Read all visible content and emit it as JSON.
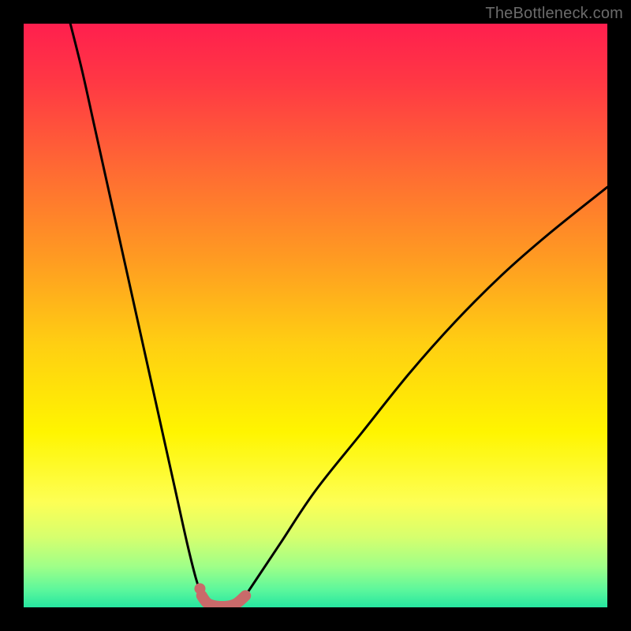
{
  "watermark": {
    "text": "TheBottleneck.com"
  },
  "colors": {
    "gradient_stops": [
      {
        "offset": 0.0,
        "color": "#ff1f4e"
      },
      {
        "offset": 0.1,
        "color": "#ff3844"
      },
      {
        "offset": 0.25,
        "color": "#ff6a33"
      },
      {
        "offset": 0.4,
        "color": "#ff9a22"
      },
      {
        "offset": 0.55,
        "color": "#ffcf12"
      },
      {
        "offset": 0.7,
        "color": "#fff500"
      },
      {
        "offset": 0.82,
        "color": "#fdff55"
      },
      {
        "offset": 0.88,
        "color": "#d6ff6e"
      },
      {
        "offset": 0.93,
        "color": "#9fff88"
      },
      {
        "offset": 0.97,
        "color": "#5cf79c"
      },
      {
        "offset": 1.0,
        "color": "#26e6a0"
      }
    ],
    "curve": "#000000",
    "marker": "#c96a6a"
  },
  "chart_data": {
    "type": "line",
    "title": "",
    "xlabel": "",
    "ylabel": "",
    "xlim": [
      0,
      100
    ],
    "ylim": [
      0,
      100
    ],
    "grid": false,
    "legend": false,
    "series": [
      {
        "name": "left-branch",
        "x": [
          8,
          10,
          12,
          14,
          16,
          18,
          20,
          22,
          24,
          26,
          28,
          29.5,
          30.5
        ],
        "y": [
          100,
          92,
          83,
          74,
          65,
          56,
          47,
          38,
          29,
          20,
          11,
          5,
          2
        ]
      },
      {
        "name": "right-branch",
        "x": [
          38,
          40,
          44,
          50,
          58,
          66,
          74,
          82,
          90,
          100
        ],
        "y": [
          2,
          5,
          11,
          20,
          30,
          40,
          49,
          57,
          64,
          72
        ]
      },
      {
        "name": "floor-marker",
        "x": [
          30.5,
          31.5,
          33,
          35,
          36.5,
          38
        ],
        "y": [
          2,
          0.7,
          0.2,
          0.2,
          0.7,
          2
        ]
      }
    ],
    "annotations": [
      {
        "type": "dot",
        "x": 30.2,
        "y": 3.2
      }
    ]
  }
}
